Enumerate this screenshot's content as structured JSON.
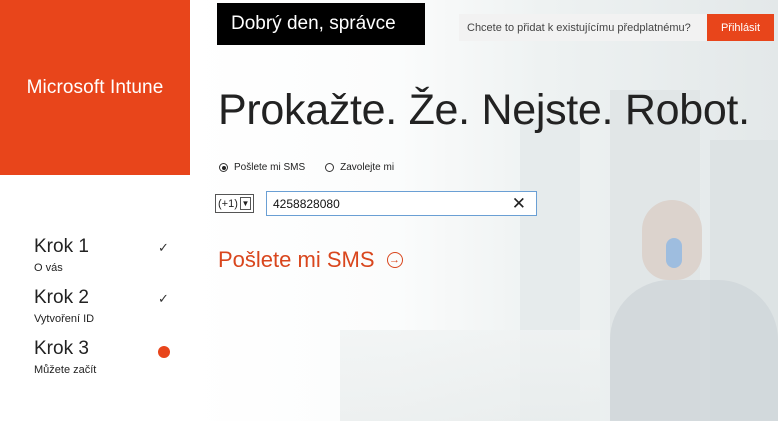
{
  "brand": {
    "name": "Microsoft Intune",
    "color": "#e8451b"
  },
  "header": {
    "greeting": "Dobrý den, správce",
    "signin_question": "Chcete to přidat k existujícímu předplatnému?",
    "signin_button": "Přihlásit"
  },
  "main": {
    "headline": "Prokažte. Že. Nejste. Robot.",
    "options": [
      {
        "label": "Pošlete mi SMS",
        "selected": true
      },
      {
        "label": "Zavolejte mi",
        "selected": false
      }
    ],
    "country_code": "(+1)",
    "phone_number": "4258828080",
    "send_link": "Pošlete mi SMS"
  },
  "steps": [
    {
      "title": "Krok 1",
      "subtitle": "O vás",
      "status": "done"
    },
    {
      "title": "Krok 2",
      "subtitle": "Vytvoření ID",
      "status": "done"
    },
    {
      "title": "Krok 3",
      "subtitle": "Můžete začít",
      "status": "current"
    }
  ],
  "icons": {
    "check": "checkmark-icon",
    "current": "current-step-dot-icon",
    "clear": "close-icon",
    "arrow": "arrow-right-circle-icon",
    "dropdown": "chevron-down-icon"
  }
}
